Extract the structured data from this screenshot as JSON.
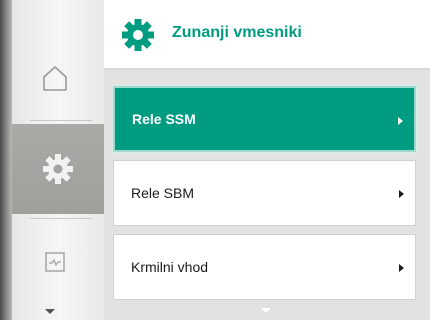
{
  "colors": {
    "accent": "#009c82",
    "nav_selected": "#a3a4a0",
    "list_background": "#e2e2e2"
  },
  "header": {
    "icon": "gear-icon",
    "title": "Zunanji vmesniki"
  },
  "nav": {
    "items": [
      {
        "icon": "home-icon",
        "selected": false
      },
      {
        "icon": "gear-icon",
        "selected": true
      },
      {
        "icon": "diagnostics-icon",
        "selected": false
      }
    ]
  },
  "menu": {
    "items": [
      {
        "label": "Rele SSM",
        "selected": true
      },
      {
        "label": "Rele SBM",
        "selected": false
      },
      {
        "label": "Krmilni vhod",
        "selected": false
      }
    ]
  }
}
